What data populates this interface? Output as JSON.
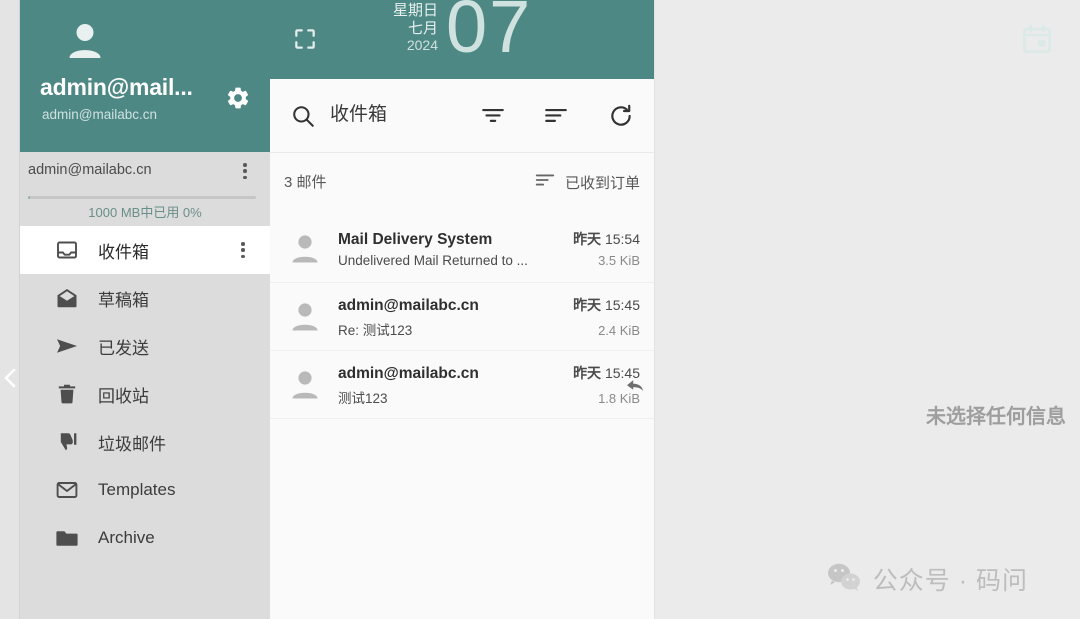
{
  "theme": {
    "accent_teal": "#4d8884",
    "sidebar_bg": "#dcdcdc",
    "list_bg": "#fafafa",
    "right_bg": "#ebebeb"
  },
  "account": {
    "display_name": "admin@mail...",
    "email": "admin@mailabc.cn",
    "avatar_icon": "person-icon",
    "settings_icon": "gear-icon",
    "row_label": "admin@mailabc.cn",
    "row_menu_icon": "more-vertical-icon",
    "storage_text": "1000 MB中已用 0%",
    "storage_percent": 1
  },
  "sidebar": {
    "collapse_icon": "chevron-left-icon",
    "folders": [
      {
        "label": "收件箱",
        "icon": "inbox-icon",
        "active": true,
        "menu_icon": "more-vertical-icon"
      },
      {
        "label": "草稿箱",
        "icon": "draft-icon",
        "active": false,
        "menu_icon": ""
      },
      {
        "label": "已发送",
        "icon": "send-icon",
        "active": false,
        "menu_icon": ""
      },
      {
        "label": "回收站",
        "icon": "trash-icon",
        "active": false,
        "menu_icon": ""
      },
      {
        "label": "垃圾邮件",
        "icon": "thumbs-down-icon",
        "active": false,
        "menu_icon": ""
      },
      {
        "label": "Templates",
        "icon": "envelope-icon",
        "active": false,
        "menu_icon": ""
      },
      {
        "label": "Archive",
        "icon": "folder-icon",
        "active": false,
        "menu_icon": ""
      }
    ]
  },
  "header": {
    "expand_icon": "fullscreen-icon",
    "weekday": "星期日",
    "month": "七月",
    "year": "2024",
    "day": "07",
    "calendar_icon": "calendar-icon"
  },
  "toolbar": {
    "search_icon": "search-icon",
    "title": "收件箱",
    "filter_icon": "filter-icon",
    "sort_icon": "sort-icon",
    "refresh_icon": "refresh-icon"
  },
  "list_header": {
    "count_text": "3 邮件",
    "sort_icon": "sort-icon",
    "sort_label": "已收到订单"
  },
  "mails": [
    {
      "from": "Mail Delivery System",
      "date": "昨天",
      "time": "15:54",
      "subject": "Undelivered Mail Returned to ...",
      "size": "3.5 KiB",
      "avatar_icon": "person-icon",
      "replied": false
    },
    {
      "from": "admin@mailabc.cn",
      "date": "昨天",
      "time": "15:45",
      "subject": "Re: 测试123",
      "size": "2.4 KiB",
      "avatar_icon": "person-icon",
      "replied": false
    },
    {
      "from": "admin@mailabc.cn",
      "date": "昨天",
      "time": "15:45",
      "subject": "测试123",
      "size": "1.8 KiB",
      "avatar_icon": "person-icon",
      "replied": true,
      "replied_icon": "reply-arrow-icon"
    }
  ],
  "reading_pane": {
    "empty_text": "未选择任何信息"
  },
  "watermark": {
    "icon": "wechat-icon",
    "text": "公众号 · 码问"
  }
}
